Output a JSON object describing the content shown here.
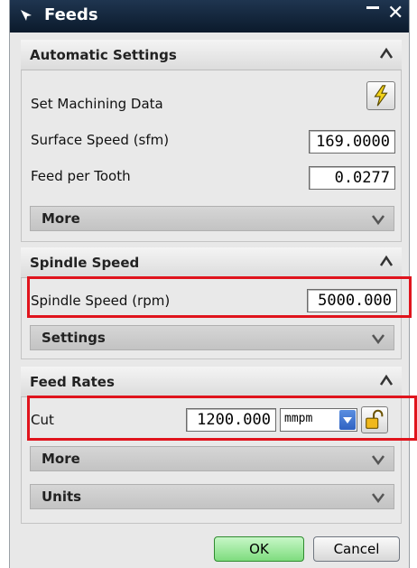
{
  "window": {
    "title": "Feeds"
  },
  "automatic_settings": {
    "header": "Automatic Settings",
    "set_machining_data_label": "Set Machining Data",
    "surface_speed_label": "Surface Speed (sfm)",
    "surface_speed_value": "169.0000",
    "feed_per_tooth_label": "Feed per Tooth",
    "feed_per_tooth_value": "0.0277",
    "more_label": "More"
  },
  "spindle_speed": {
    "header": "Spindle Speed",
    "rpm_label": "Spindle Speed (rpm)",
    "rpm_value": "5000.000",
    "settings_label": "Settings"
  },
  "feed_rates": {
    "header": "Feed Rates",
    "cut_label": "Cut",
    "cut_value": "1200.000",
    "cut_unit": "mmpm",
    "more_label": "More",
    "units_label": "Units"
  },
  "buttons": {
    "ok": "OK",
    "cancel": "Cancel"
  },
  "colors": {
    "highlight": "#e0141d",
    "titlebar": "#0b1a2c",
    "ok_button": "#7edc7e"
  }
}
